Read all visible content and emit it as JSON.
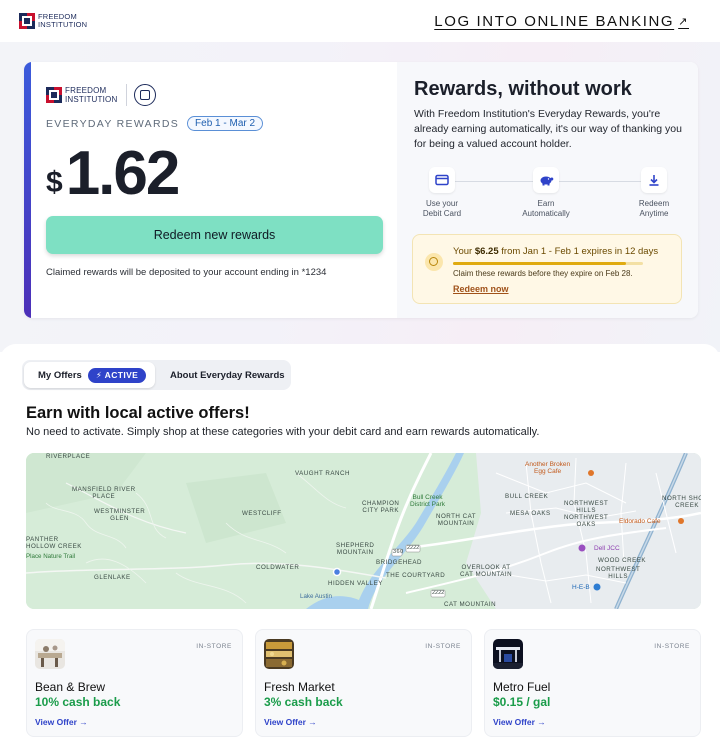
{
  "header": {
    "logo_line1": "Freedom",
    "logo_line2": "Institution",
    "login_label": "LOG INTO ONLINE BANKING"
  },
  "rewards": {
    "program_name": "EVERYDAY REWARDS",
    "date_range": "Feb 1 - Mar 2",
    "currency": "$",
    "amount": "1.62",
    "redeem_button": "Redeem new rewards",
    "claim_note": "Claimed rewards will be deposited to your account ending in *1234"
  },
  "info": {
    "title": "Rewards, without work",
    "description": "With Freedom Institution's Everyday Rewards, you're already earning automatically, it's our way of thanking you for being a valued account holder.",
    "steps": [
      {
        "label_line1": "Use your",
        "label_line2": "Debit Card",
        "icon": "credit-card-icon"
      },
      {
        "label_line1": "Earn",
        "label_line2": "Automatically",
        "icon": "piggy-bank-icon"
      },
      {
        "label_line1": "Redeem",
        "label_line2": "Anytime",
        "icon": "download-icon"
      }
    ]
  },
  "expiry": {
    "prefix": "Your",
    "amount": "$6.25",
    "suffix": "from Jan 1 - Feb 1 expires in 12 days",
    "progress": 0.91,
    "subtext": "Claim these rewards before they expire on Feb 28.",
    "link": "Redeem now"
  },
  "tabs": {
    "offers_label": "My Offers",
    "active_badge": "ACTIVE",
    "about_label": "About Everyday Rewards"
  },
  "section": {
    "title": "Earn with local active offers!",
    "subtitle": "No need to activate. Simply shop at these categories with your debit card and earn rewards automatically."
  },
  "map": {
    "labels": {
      "riverplace": "RIVERPLACE",
      "vaught": "VAUGHT RANCH",
      "mansfield": "MANSFIELD RIVER\nPLACE",
      "westminster": "WESTMINSTER\nGLEN",
      "westcliff": "WESTCLIFF",
      "champion": "CHAMPION\nCITY PARK",
      "bullcreek_park": "Bull Creek\nDistrict Park",
      "bullcreek": "BULL CREEK",
      "northcat": "NORTH CAT\nMOUNTAIN",
      "mesaoaks": "MESA OAKS",
      "nwhills": "NORTHWEST\nHILLS\nNORTHWEST\nOAKS",
      "northshoal": "NORTH SHOAL\nCREEK",
      "panther": "PANTHER\nHOLLOW CREEK",
      "naturetrail": "Place Nature Trail",
      "glenlake": "GLENLAKE",
      "shepherd": "SHEPHERD\nMOUNTAIN",
      "bridgehead": "BRIDGEHEAD",
      "coldwater": "COLDWATER",
      "hiddenvalley": "HIDDEN VALLEY",
      "courtyard": "THE COURTYARD",
      "overlook": "OVERLOOK AT\nCAT MOUNTAIN",
      "woodcreek": "WOOD CREEK",
      "nwhills2": "NORTHWEST\nHILLS",
      "catmountain": "CAT MOUNTAIN",
      "lakeaustin": "Lake Austin",
      "r360": "360",
      "r2222a": "2222",
      "r2222b": "2222"
    },
    "pois": {
      "broken_egg": "Another Broken\nEgg Cafe",
      "eldorado": "Eldorado Cafe",
      "dell_jcc": "Dell JCC",
      "heb": "H-E-B"
    }
  },
  "offers": [
    {
      "tag": "IN-STORE",
      "name": "Bean & Brew",
      "reward": "10% cash back",
      "link": "View Offer",
      "icon": "coffee-shop-thumbnail"
    },
    {
      "tag": "IN-STORE",
      "name": "Fresh Market",
      "reward": "3% cash back",
      "link": "View Offer",
      "icon": "grocery-thumbnail"
    },
    {
      "tag": "IN-STORE",
      "name": "Metro Fuel",
      "reward": "$0.15 / gal",
      "link": "View Offer",
      "icon": "gas-station-thumbnail"
    }
  ],
  "colors": {
    "accent": "#2f43c9",
    "redeem": "#7ee0c3",
    "cashback": "#1a9c4a",
    "warning_bg": "#fff8e6"
  }
}
